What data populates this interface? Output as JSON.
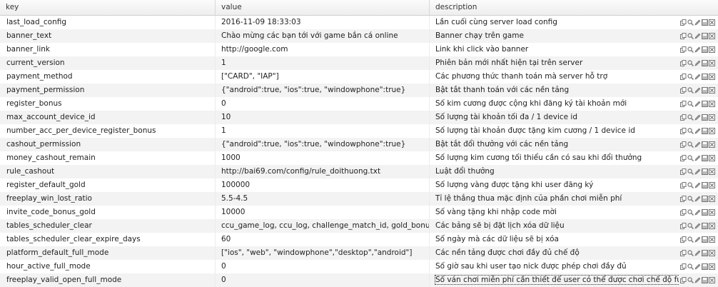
{
  "columns": {
    "key": "key",
    "value": "value",
    "description": "description"
  },
  "rows": [
    {
      "key": "last_load_config",
      "value": "2016-11-09 18:33:03",
      "description": "Lần cuối cùng server load config"
    },
    {
      "key": "banner_text",
      "value": "Chào mừng các bạn tới với game bắn cá online",
      "description": "Banner chạy trên game"
    },
    {
      "key": "banner_link",
      "value": "http://google.com",
      "description": "Link khi click vào banner"
    },
    {
      "key": "current_version",
      "value": "1",
      "description": "Phiên bản mới nhất hiện tại trên server"
    },
    {
      "key": "payment_method",
      "value": "[\"CARD\", \"IAP\"]",
      "description": "Các phương thức thanh toán mà server hỗ trợ"
    },
    {
      "key": "payment_permission",
      "value": "{\"android\":true, \"ios\":true, \"windowphone\":true}",
      "description": "Bật tắt thanh toán với các nền tảng"
    },
    {
      "key": "register_bonus",
      "value": "0",
      "description": "Số kim cương được cộng khi đăng ký tài khoản mới"
    },
    {
      "key": "max_account_device_id",
      "value": "10",
      "description": "Số lượng tài khoản tối đa / 1 device id"
    },
    {
      "key": "number_acc_per_device_register_bonus",
      "value": "1",
      "description": "Số lượng tài khoản được tặng kim cương / 1 device id"
    },
    {
      "key": "cashout_permission",
      "value": "{\"android\":true, \"ios\":true, \"windowphone\":true}",
      "description": "Bật tắt đổi thưởng với các nền tảng"
    },
    {
      "key": "money_cashout_remain",
      "value": "1000",
      "description": "Số lượng kim cương tối thiểu cần có sau khi đổi thưởng"
    },
    {
      "key": "rule_cashout",
      "value": "http://bai69.com/config/rule_doithuong.txt",
      "description": "Luật đổi thưởng"
    },
    {
      "key": "register_default_gold",
      "value": "100000",
      "description": "Số lượng vàng được tặng khi user đăng ký"
    },
    {
      "key": "freeplay_win_lost_ratio",
      "value": "5.5-4.5",
      "description": "Tỉ lệ thắng thua mặc định của phần chơi miễn phí"
    },
    {
      "key": "invite_code_bonus_gold",
      "value": "10000",
      "description": "Số vàng tặng khi nhập code mời"
    },
    {
      "key": "tables_scheduler_clear",
      "value": "ccu_game_log, ccu_log, challenge_match_id, gold_bonus...",
      "description": "Các bảng sẽ bị đặt lịch xóa dữ liệu"
    },
    {
      "key": "tables_scheduler_clear_expire_days",
      "value": "60",
      "description": "Số ngày mà các dữ liệu sẽ bị xóa"
    },
    {
      "key": "platform_default_full_mode",
      "value": "[\"ios\", \"web\", \"windowphone\",\"desktop\",\"android\"]",
      "description": "Các nền tảng được chơi đầy đủ chế độ"
    },
    {
      "key": "hour_active_full_mode",
      "value": "0",
      "description": "Số giờ sau khi user tạo nick được phép chơi đầy đủ"
    },
    {
      "key": "freeplay_valid_open_full_mode",
      "value": "0",
      "description": "Số ván chơi miễn phí cần thiết để user có thể được chơi chế độ full"
    }
  ],
  "row_actions": [
    "copy-icon",
    "search-icon",
    "edit-icon",
    "save-icon",
    "delete-icon"
  ],
  "selected_row_index": 19
}
